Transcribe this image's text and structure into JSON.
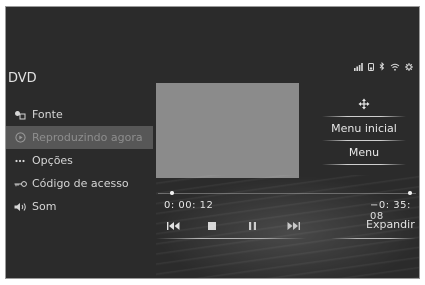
{
  "screen": {
    "title": "DVD",
    "status_icons": [
      "signal-icon",
      "phone-icon",
      "bluetooth-icon",
      "wifi-icon",
      "settings-icon"
    ]
  },
  "sidebar": {
    "items": [
      {
        "label": "Fonte",
        "icon": "source-icon",
        "active": false
      },
      {
        "label": "Reproduzindo agora",
        "icon": "now-playing-icon",
        "active": true
      },
      {
        "label": "Opções",
        "icon": "options-icon",
        "active": false
      },
      {
        "label": "Código de acesso",
        "icon": "access-code-icon",
        "active": false
      },
      {
        "label": "Som",
        "icon": "sound-icon",
        "active": false
      }
    ]
  },
  "right_panel": {
    "move_icon": "move-icon",
    "menu_inicial": "Menu inicial",
    "menu": "Menu"
  },
  "playback": {
    "elapsed": "0: 00: 12",
    "remaining": "−0: 35: 08",
    "progress_fraction": 0.01,
    "expand_label": "Expandir"
  },
  "colors": {
    "background": "#2b2b2b",
    "active_item": "#575757",
    "video_area": "#8b8b8b",
    "text": "#e6e6e6"
  }
}
